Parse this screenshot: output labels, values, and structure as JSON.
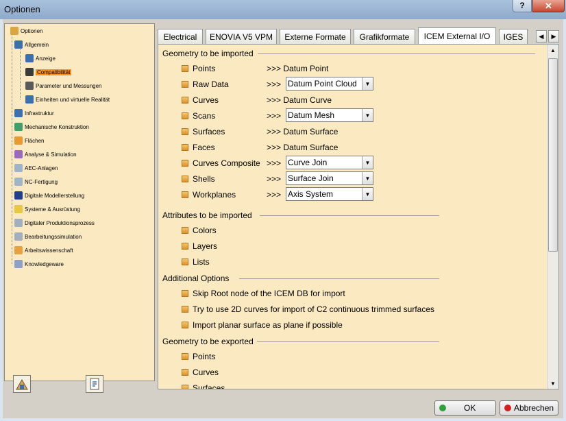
{
  "window": {
    "title": "Optionen",
    "help_label": "?",
    "close_label": "✕"
  },
  "tree": {
    "items": [
      {
        "label": "Optionen",
        "icon": "options-root-icon",
        "color": "#d9a640"
      },
      {
        "label": "Allgemein",
        "icon": "general-icon",
        "color": "#3a6fb0"
      },
      {
        "label": "Anzeige",
        "icon": "display-icon",
        "color": "#3a6fb0"
      },
      {
        "label": "Compatibilität",
        "icon": "compatibility-icon",
        "color": "#3b3b3b",
        "selected": true
      },
      {
        "label": "Parameter und Messungen",
        "icon": "parameters-icon",
        "color": "#5a5a5a"
      },
      {
        "label": "Einheiten und virtuelle Realität",
        "icon": "units-vr-icon",
        "color": "#3a6fb0"
      },
      {
        "label": "Infrastruktur",
        "icon": "infrastructure-icon",
        "color": "#3a6fb0"
      },
      {
        "label": "Mechanische Konstruktion",
        "icon": "mechanical-design-icon",
        "color": "#3f9f6a"
      },
      {
        "label": "Flächen",
        "icon": "surfaces-icon",
        "color": "#e89a2e"
      },
      {
        "label": "Analyse & Simulation",
        "icon": "analysis-icon",
        "color": "#9a6ac0"
      },
      {
        "label": "AEC-Anlagen",
        "icon": "aec-plant-icon",
        "color": "#9fb4c8"
      },
      {
        "label": "NC-Fertigung",
        "icon": "nc-manufacturing-icon",
        "color": "#9fb4c8"
      },
      {
        "label": "Digitale Modellerstellung",
        "icon": "digital-mockup-icon",
        "color": "#1d3f8c"
      },
      {
        "label": "Systeme & Ausrüstung",
        "icon": "equipment-icon",
        "color": "#e8c840"
      },
      {
        "label": "Digitaler Produktionsprozess",
        "icon": "production-process-icon",
        "color": "#a0b0c0"
      },
      {
        "label": "Bearbeitungssimulation",
        "icon": "machining-simulation-icon",
        "color": "#a0b0c0"
      },
      {
        "label": "Arbeitswissenschaft",
        "icon": "ergonomics-icon",
        "color": "#e8a040"
      },
      {
        "label": "Knowledgeware",
        "icon": "knowledgeware-icon",
        "color": "#8fa0c8"
      }
    ]
  },
  "tabs": [
    {
      "label": "Electrical"
    },
    {
      "label": "ENOVIA V5 VPM"
    },
    {
      "label": "Externe Formate"
    },
    {
      "label": "Grafikformate"
    },
    {
      "label": "ICEM External I/O",
      "active": true
    },
    {
      "label": "IGES"
    }
  ],
  "sections": {
    "geometry_import": "Geometry to be imported",
    "attributes_import": "Attributes to be imported",
    "additional_options": "Additional Options",
    "geometry_export": "Geometry to be exported"
  },
  "import_rows": [
    {
      "label": "Points",
      "mapping": ">>> Datum Point"
    },
    {
      "label": "Raw Data",
      "prefix": ">>>",
      "combo": "Datum Point Cloud"
    },
    {
      "label": "Curves",
      "mapping": ">>> Datum Curve"
    },
    {
      "label": "Scans",
      "prefix": ">>>",
      "combo": "Datum Mesh"
    },
    {
      "label": "Surfaces",
      "mapping": ">>> Datum Surface"
    },
    {
      "label": "Faces",
      "mapping": ">>> Datum Surface"
    },
    {
      "label": "Curves Composite",
      "prefix": ">>>",
      "combo": "Curve Join"
    },
    {
      "label": "Shells",
      "prefix": ">>>",
      "combo": "Surface Join"
    },
    {
      "label": "Workplanes",
      "prefix": ">>>",
      "combo": "Axis System"
    }
  ],
  "attribute_rows": [
    "Colors",
    "Layers",
    "Lists"
  ],
  "option_rows": [
    "Skip Root node of the ICEM DB for import",
    "Try to use 2D curves for import of C2 continuous trimmed surfaces",
    "Import planar surface as plane if possible"
  ],
  "export_rows": [
    "Points",
    "Curves",
    "Surfaces"
  ],
  "buttons": {
    "ok": "OK",
    "cancel": "Abbrechen",
    "ok_color": "#2fa33a",
    "cancel_color": "#d42020"
  }
}
